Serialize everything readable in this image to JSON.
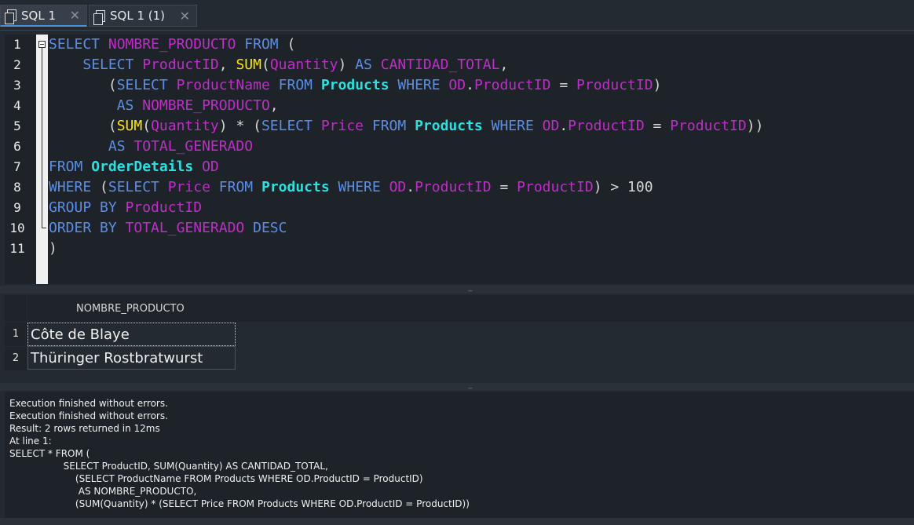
{
  "tabs": [
    {
      "label": "SQL 1",
      "active": true
    },
    {
      "label": "SQL 1 (1)",
      "active": false
    }
  ],
  "editor": {
    "line_numbers": [
      "1",
      "2",
      "3",
      "4",
      "5",
      "6",
      "7",
      "8",
      "9",
      "10",
      "11"
    ],
    "colors": {
      "keyword": "#5b8ee6",
      "function": "#ffe600",
      "identifier": "#c02dc8",
      "table": "#2de0e0",
      "plain": "#d6d6d6"
    },
    "lines": [
      [
        [
          "kw",
          "SELECT"
        ],
        [
          "pl",
          " "
        ],
        [
          "id",
          "NOMBRE_PRODUCTO"
        ],
        [
          "pl",
          " "
        ],
        [
          "kw",
          "FROM"
        ],
        [
          "pl",
          " ("
        ]
      ],
      [
        [
          "pl",
          "    "
        ],
        [
          "kw",
          "SELECT"
        ],
        [
          "pl",
          " "
        ],
        [
          "id",
          "ProductID"
        ],
        [
          "pl",
          ", "
        ],
        [
          "fn",
          "SUM"
        ],
        [
          "pl",
          "("
        ],
        [
          "id",
          "Quantity"
        ],
        [
          "pl",
          ") "
        ],
        [
          "kw",
          "AS"
        ],
        [
          "pl",
          " "
        ],
        [
          "id",
          "CANTIDAD_TOTAL"
        ],
        [
          "pl",
          ","
        ]
      ],
      [
        [
          "pl",
          "       ("
        ],
        [
          "kw",
          "SELECT"
        ],
        [
          "pl",
          " "
        ],
        [
          "id",
          "ProductName"
        ],
        [
          "pl",
          " "
        ],
        [
          "kw",
          "FROM"
        ],
        [
          "pl",
          " "
        ],
        [
          "tb",
          "Products"
        ],
        [
          "pl",
          " "
        ],
        [
          "kw",
          "WHERE"
        ],
        [
          "pl",
          " "
        ],
        [
          "id",
          "OD"
        ],
        [
          "pl",
          "."
        ],
        [
          "id",
          "ProductID"
        ],
        [
          "pl",
          " = "
        ],
        [
          "id",
          "ProductID"
        ],
        [
          "pl",
          ")"
        ]
      ],
      [
        [
          "pl",
          "        "
        ],
        [
          "kw",
          "AS"
        ],
        [
          "pl",
          " "
        ],
        [
          "id",
          "NOMBRE_PRODUCTO"
        ],
        [
          "pl",
          ","
        ]
      ],
      [
        [
          "pl",
          "       ("
        ],
        [
          "fn",
          "SUM"
        ],
        [
          "pl",
          "("
        ],
        [
          "id",
          "Quantity"
        ],
        [
          "pl",
          ") * ("
        ],
        [
          "kw",
          "SELECT"
        ],
        [
          "pl",
          " "
        ],
        [
          "id",
          "Price"
        ],
        [
          "pl",
          " "
        ],
        [
          "kw",
          "FROM"
        ],
        [
          "pl",
          " "
        ],
        [
          "tb",
          "Products"
        ],
        [
          "pl",
          " "
        ],
        [
          "kw",
          "WHERE"
        ],
        [
          "pl",
          " "
        ],
        [
          "id",
          "OD"
        ],
        [
          "pl",
          "."
        ],
        [
          "id",
          "ProductID"
        ],
        [
          "pl",
          " = "
        ],
        [
          "id",
          "ProductID"
        ],
        [
          "pl",
          "))"
        ]
      ],
      [
        [
          "pl",
          "       "
        ],
        [
          "kw",
          "AS"
        ],
        [
          "pl",
          " "
        ],
        [
          "id",
          "TOTAL_GENERADO"
        ]
      ],
      [
        [
          "kw",
          "FROM"
        ],
        [
          "pl",
          " "
        ],
        [
          "tb",
          "OrderDetails"
        ],
        [
          "pl",
          " "
        ],
        [
          "id",
          "OD"
        ]
      ],
      [
        [
          "kw",
          "WHERE"
        ],
        [
          "pl",
          " ("
        ],
        [
          "kw",
          "SELECT"
        ],
        [
          "pl",
          " "
        ],
        [
          "id",
          "Price"
        ],
        [
          "pl",
          " "
        ],
        [
          "kw",
          "FROM"
        ],
        [
          "pl",
          " "
        ],
        [
          "tb",
          "Products"
        ],
        [
          "pl",
          " "
        ],
        [
          "kw",
          "WHERE"
        ],
        [
          "pl",
          " "
        ],
        [
          "id",
          "OD"
        ],
        [
          "pl",
          "."
        ],
        [
          "id",
          "ProductID"
        ],
        [
          "pl",
          " = "
        ],
        [
          "id",
          "ProductID"
        ],
        [
          "pl",
          ") > 100"
        ]
      ],
      [
        [
          "kw",
          "GROUP BY"
        ],
        [
          "pl",
          " "
        ],
        [
          "id",
          "ProductID"
        ]
      ],
      [
        [
          "kw",
          "ORDER BY"
        ],
        [
          "pl",
          " "
        ],
        [
          "id",
          "TOTAL_GENERADO"
        ],
        [
          "pl",
          " "
        ],
        [
          "kw",
          "DESC"
        ]
      ],
      [
        [
          "pl",
          ")"
        ]
      ]
    ]
  },
  "results": {
    "column": "NOMBRE_PRODUCTO",
    "rows": [
      {
        "num": "1",
        "value": "Côte de Blaye"
      },
      {
        "num": "2",
        "value": "Thüringer Rostbratwurst"
      }
    ]
  },
  "messages": [
    "Execution finished without errors.",
    "Execution finished without errors.",
    "Result: 2 rows returned in 12ms",
    "At line 1:",
    "SELECT * FROM (",
    "                  SELECT ProductID, SUM(Quantity) AS CANTIDAD_TOTAL,",
    "                      (SELECT ProductName FROM Products WHERE OD.ProductID = ProductID)",
    "                       AS NOMBRE_PRODUCTO,",
    "                      (SUM(Quantity) * (SELECT Price FROM Products WHERE OD.ProductID = ProductID))"
  ]
}
